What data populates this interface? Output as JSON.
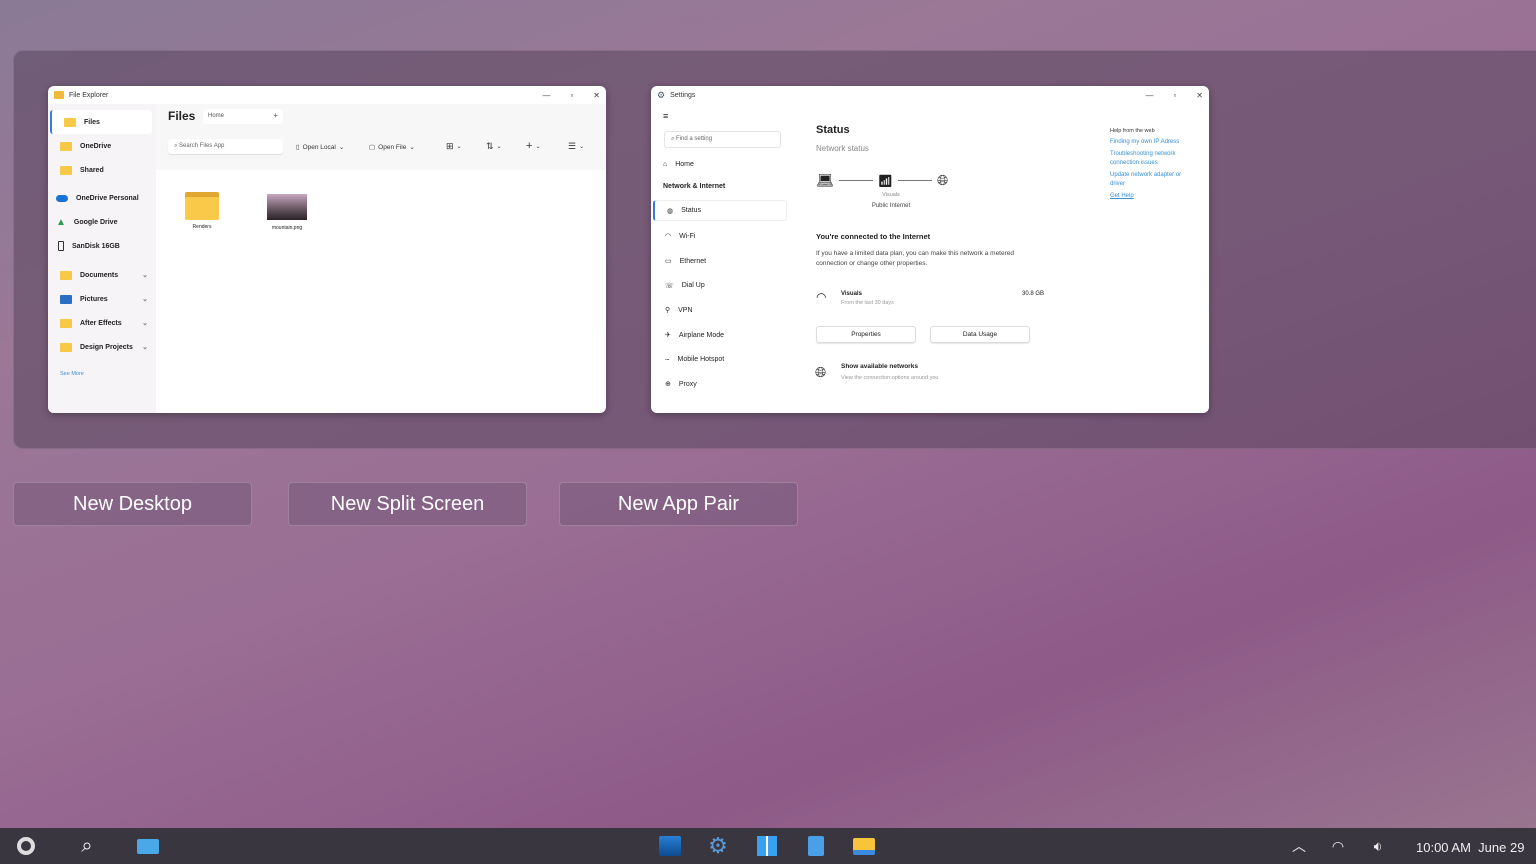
{
  "file_explorer": {
    "title": "File Explorer",
    "heading": "Files",
    "tab": "Home",
    "add_tab": "+",
    "search_placeholder": "Search Files App",
    "toolbar": {
      "open_local": "Open Local",
      "open_file": "Open File"
    },
    "sidebar": [
      {
        "label": "Files",
        "icon": "folder-icon"
      },
      {
        "label": "OneDrive",
        "icon": "folder-icon"
      },
      {
        "label": "Shared",
        "icon": "folder-icon"
      },
      {
        "label": "OneDrive Personal",
        "icon": "cloud-icon"
      },
      {
        "label": "Google Drive",
        "icon": "google-drive-icon"
      },
      {
        "label": "SanDisk 16GB",
        "icon": "usb-drive-icon"
      },
      {
        "label": "Documents",
        "icon": "folder-icon"
      },
      {
        "label": "Pictures",
        "icon": "pictures-icon"
      },
      {
        "label": "After Effects",
        "icon": "folder-icon"
      },
      {
        "label": "Design Projects",
        "icon": "folder-icon"
      }
    ],
    "see_more": "See More",
    "items": [
      {
        "name": "Renders",
        "type": "folder"
      },
      {
        "name": "mountain.png",
        "type": "image"
      }
    ]
  },
  "settings": {
    "title": "Settings",
    "search_placeholder": "Find a setting",
    "home": "Home",
    "section": "Network & Internet",
    "nav": [
      "Status",
      "Wi-Fi",
      "Ethernet",
      "Dial Up",
      "VPN",
      "Airplane Mode",
      "Mobile Hotspot",
      "Proxy"
    ],
    "heading": "Status",
    "subheading": "Network status",
    "network_name": "Visuals",
    "network_type": "Public Internet",
    "connected_title": "You're connected to the Internet",
    "connected_desc": "If you have a limited data plan, you can make this network a metered connection or change other properties.",
    "usage_name": "Visuals",
    "usage_period": "From the last 30 days",
    "usage_amount": "30.8 GB",
    "btn_properties": "Properties",
    "btn_data_usage": "Data Usage",
    "show_networks": "Show available networks",
    "show_networks_desc": "View the connection options around you",
    "help_title": "Help from the web",
    "help_links": [
      "Finding my own IP Adress",
      "Troubleshooting network connection issues",
      "Update network adapter or driver",
      "Get Help"
    ]
  },
  "actions": {
    "new_desktop": "New Desktop",
    "new_split": "New Split Screen",
    "new_pair": "New App Pair"
  },
  "taskbar": {
    "time": "10:00 AM",
    "date": "June 29"
  }
}
